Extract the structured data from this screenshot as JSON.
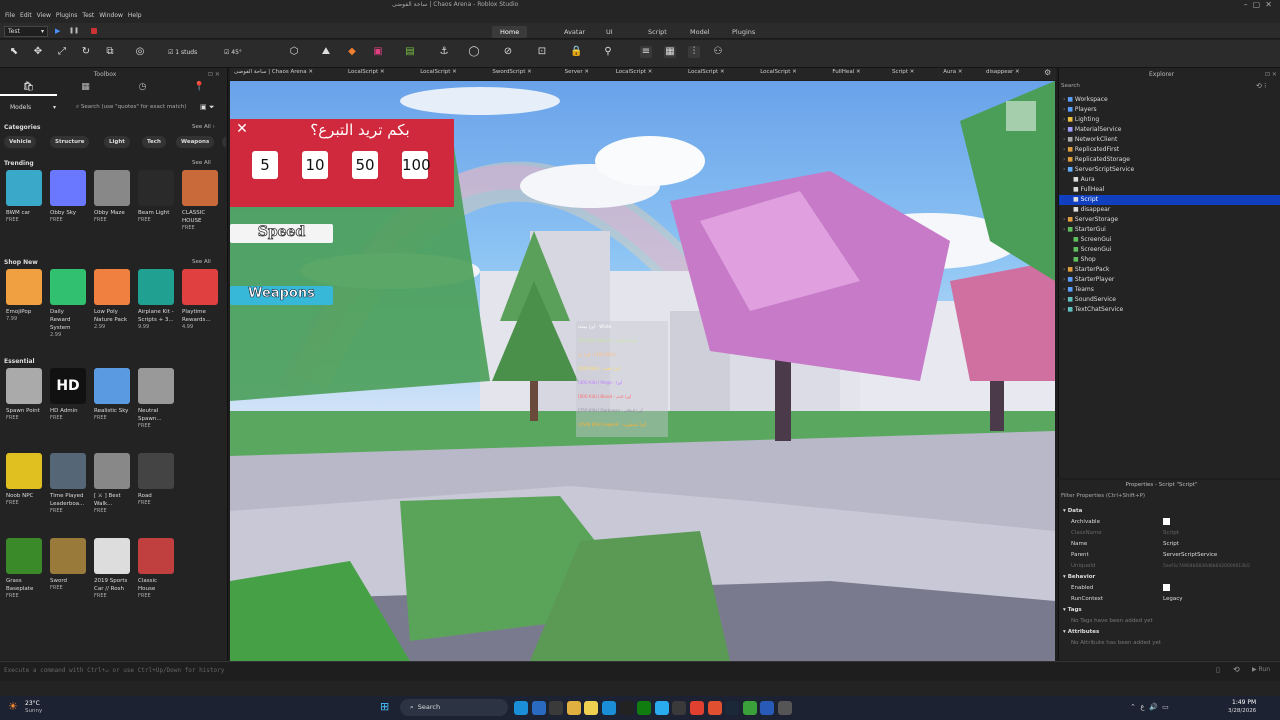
{
  "window": {
    "title": "ساحة الفوضى | Chaos Arena - Roblox Studio"
  },
  "menu": [
    "File",
    "Edit",
    "View",
    "Plugins",
    "Test",
    "Window",
    "Help"
  ],
  "ribbon": {
    "mode_select": "Test",
    "tabs": [
      "Home",
      "Avatar",
      "UI",
      "Script",
      "Model",
      "Plugins"
    ],
    "active_tab": "Home",
    "studs_value": "1 studs",
    "rotate_value": "45°"
  },
  "toolbox": {
    "title": "Toolbox",
    "filter": "Models",
    "search_placeholder": "Search (use \"quotes\" for exact match)",
    "categories_title": "Categories",
    "see_all": "See All",
    "categories": [
      "Vehicle",
      "Structure",
      "Light",
      "Tech",
      "Weapons",
      "Landscape"
    ],
    "sections": [
      {
        "title": "Trending",
        "items": [
          {
            "name": "BWM car",
            "price": "FREE",
            "icon": "car-icon",
            "color": "#3aa8c8"
          },
          {
            "name": "Obby Sky",
            "price": "FREE",
            "icon": "sky-icon",
            "color": "#6a78ff"
          },
          {
            "name": "Obby Maze",
            "price": "FREE",
            "icon": "maze-icon",
            "color": "#888888"
          },
          {
            "name": "Beam Light",
            "price": "FREE",
            "icon": "lamp-icon",
            "color": "#2a2a2a"
          },
          {
            "name": "CLASSIC HOUSE",
            "price": "FREE",
            "icon": "house-icon",
            "color": "#c86a3a"
          }
        ]
      },
      {
        "title": "Shop New",
        "items": [
          {
            "name": "EmojiPop",
            "price": "7.99",
            "icon": "emoji-icon",
            "color": "#f0a040"
          },
          {
            "name": "Daily Reward System",
            "price": "2.99",
            "icon": "calendar-icon",
            "color": "#30c070"
          },
          {
            "name": "Low Poly Nature Pack",
            "price": "2.99",
            "icon": "tree-icon",
            "color": "#f08040"
          },
          {
            "name": "Airplane Kit - Scripts + 3...",
            "price": "9.99",
            "icon": "airplane-icon",
            "color": "#20a090"
          },
          {
            "name": "Playtime Rewards...",
            "price": "4.99",
            "icon": "gift-icon",
            "color": "#e04040"
          }
        ]
      },
      {
        "title": "Essential",
        "items": [
          {
            "name": "Spawn Point",
            "price": "FREE",
            "icon": "spawn-icon",
            "color": "#aaaaaa"
          },
          {
            "name": "HD Admin",
            "price": "FREE",
            "icon": "hd-admin-icon",
            "color": "#111111"
          },
          {
            "name": "Realistic Sky",
            "price": "FREE",
            "icon": "sky-icon",
            "color": "#5a9ae0"
          },
          {
            "name": "Neutral Spawn...",
            "price": "FREE",
            "icon": "spawn-icon",
            "color": "#999999"
          },
          {
            "name": "Noob NPC",
            "price": "FREE",
            "icon": "npc-icon",
            "color": "#e0c020"
          },
          {
            "name": "Time Played Leaderboa...",
            "price": "FREE",
            "icon": "leaderboard-icon",
            "color": "#556677"
          },
          {
            "name": "[ ⚔ ] Best Walk...",
            "price": "FREE",
            "icon": "walk-icon",
            "color": "#888888"
          },
          {
            "name": "Road",
            "price": "FREE",
            "icon": "road-icon",
            "color": "#444444"
          },
          {
            "name": "Grass Baseplate",
            "price": "FREE",
            "icon": "grass-icon",
            "color": "#3a8a2a"
          },
          {
            "name": "Sword",
            "price": "FREE",
            "icon": "sword-icon",
            "color": "#9a7a3a"
          },
          {
            "name": "2019 Sports Car // Rosh",
            "price": "FREE",
            "icon": "car-icon",
            "color": "#dddddd"
          },
          {
            "name": "Classic House",
            "price": "FREE",
            "icon": "house-icon",
            "color": "#c04040"
          }
        ]
      }
    ]
  },
  "doc_tabs": [
    "ساحة الفوضى | Chaos Arena",
    "LocalScript",
    "LocalScript",
    "SwordScript",
    "Server",
    "LocalScript",
    "LocalScript",
    "LocalScript",
    "FullHeal",
    "Script",
    "Aura",
    "disappear"
  ],
  "viewport": {
    "donate_title": "بكم تريد التبرع؟",
    "donate_amounts": [
      "5",
      "10",
      "50",
      "100"
    ],
    "speed_label": "Speed",
    "weapons_label": "Weapons",
    "board_lines": [
      "أورا بيضاء - White",
      "[50 Kills] Nature - أورا الطبيعة",
      "أورا نار - [100 Kills]",
      "[200 Kills] - أورا ذهبية",
      "[400 Kills] Mega - أورا",
      "[800 Kills] Blood - أورا الدم",
      "[250 Kills] Darkness - أورا الظلام",
      "[1500 Kills] Legend - أورا أسطورية"
    ]
  },
  "explorer": {
    "title": "Explorer",
    "search_placeholder": "Search",
    "items": [
      {
        "label": "Workspace",
        "depth": 0,
        "icon": "globe-icon",
        "color": "#5aa0ff"
      },
      {
        "label": "Players",
        "depth": 0,
        "icon": "players-icon",
        "color": "#5aa0ff"
      },
      {
        "label": "Lighting",
        "depth": 0,
        "icon": "lighting-icon",
        "color": "#f0c040"
      },
      {
        "label": "MaterialService",
        "depth": 0,
        "icon": "material-icon",
        "color": "#a0a0ff"
      },
      {
        "label": "NetworkClient",
        "depth": 0,
        "icon": "network-icon",
        "color": "#aaaaaa"
      },
      {
        "label": "ReplicatedFirst",
        "depth": 0,
        "icon": "folder-icon",
        "color": "#e0a040"
      },
      {
        "label": "ReplicatedStorage",
        "depth": 0,
        "icon": "folder-icon",
        "color": "#e0a040"
      },
      {
        "label": "ServerScriptService",
        "depth": 0,
        "icon": "server-icon",
        "color": "#60b0ff"
      },
      {
        "label": "Aura",
        "depth": 1,
        "icon": "script-icon",
        "color": "#dddddd"
      },
      {
        "label": "FullHeal",
        "depth": 1,
        "icon": "script-icon",
        "color": "#dddddd"
      },
      {
        "label": "Script",
        "depth": 1,
        "icon": "script-icon",
        "color": "#dddddd"
      },
      {
        "label": "disappear",
        "depth": 1,
        "icon": "script-icon",
        "color": "#dddddd"
      },
      {
        "label": "ServerStorage",
        "depth": 0,
        "icon": "folder-icon",
        "color": "#e0a040"
      },
      {
        "label": "StarterGui",
        "depth": 0,
        "icon": "gui-icon",
        "color": "#60c060"
      },
      {
        "label": "ScreenGui",
        "depth": 1,
        "icon": "gui-icon",
        "color": "#60c060"
      },
      {
        "label": "ScreenGui",
        "depth": 1,
        "icon": "gui-icon",
        "color": "#60c060"
      },
      {
        "label": "Shop",
        "depth": 1,
        "icon": "gui-icon",
        "color": "#60c060"
      },
      {
        "label": "StarterPack",
        "depth": 0,
        "icon": "pack-icon",
        "color": "#e0a040"
      },
      {
        "label": "StarterPlayer",
        "depth": 0,
        "icon": "player-icon",
        "color": "#5aa0ff"
      },
      {
        "label": "Teams",
        "depth": 0,
        "icon": "teams-icon",
        "color": "#5aa0ff"
      },
      {
        "label": "SoundService",
        "depth": 0,
        "icon": "sound-icon",
        "color": "#60c0c0"
      },
      {
        "label": "TextChatService",
        "depth": 0,
        "icon": "chat-icon",
        "color": "#60c0c0"
      }
    ],
    "selected": "Script"
  },
  "properties": {
    "title": "Properties - Script \"Script\"",
    "filter_placeholder": "Filter Properties (Ctrl+Shift+P)",
    "data_section": "Data",
    "archivable": "Archivable",
    "classname_label": "ClassName",
    "classname_value": "Script",
    "name_label": "Name",
    "name_value": "Script",
    "parent_label": "Parent",
    "parent_value": "ServerScriptService",
    "uniqueid_label": "UniqueId",
    "uniqueid_value": "5eef3c74904b0830d0b6420000013b5",
    "behavior_section": "Behavior",
    "enabled": "Enabled",
    "runcontext_label": "RunContext",
    "runcontext_value": "Legacy",
    "tags_section": "Tags",
    "tags_empty": "No Tags have been added yet",
    "attrs_section": "Attributes",
    "attrs_empty": "No Attribute has been added yet"
  },
  "command_bar": {
    "placeholder": "Execute a command with Ctrl+↵ or use Ctrl+Up/Down for history",
    "run_label": "Run"
  },
  "taskbar": {
    "weather_temp": "23°C",
    "weather_desc": "Sunny",
    "search_label": "Search",
    "time": "1:49 PM",
    "date": "3/28/2026"
  }
}
